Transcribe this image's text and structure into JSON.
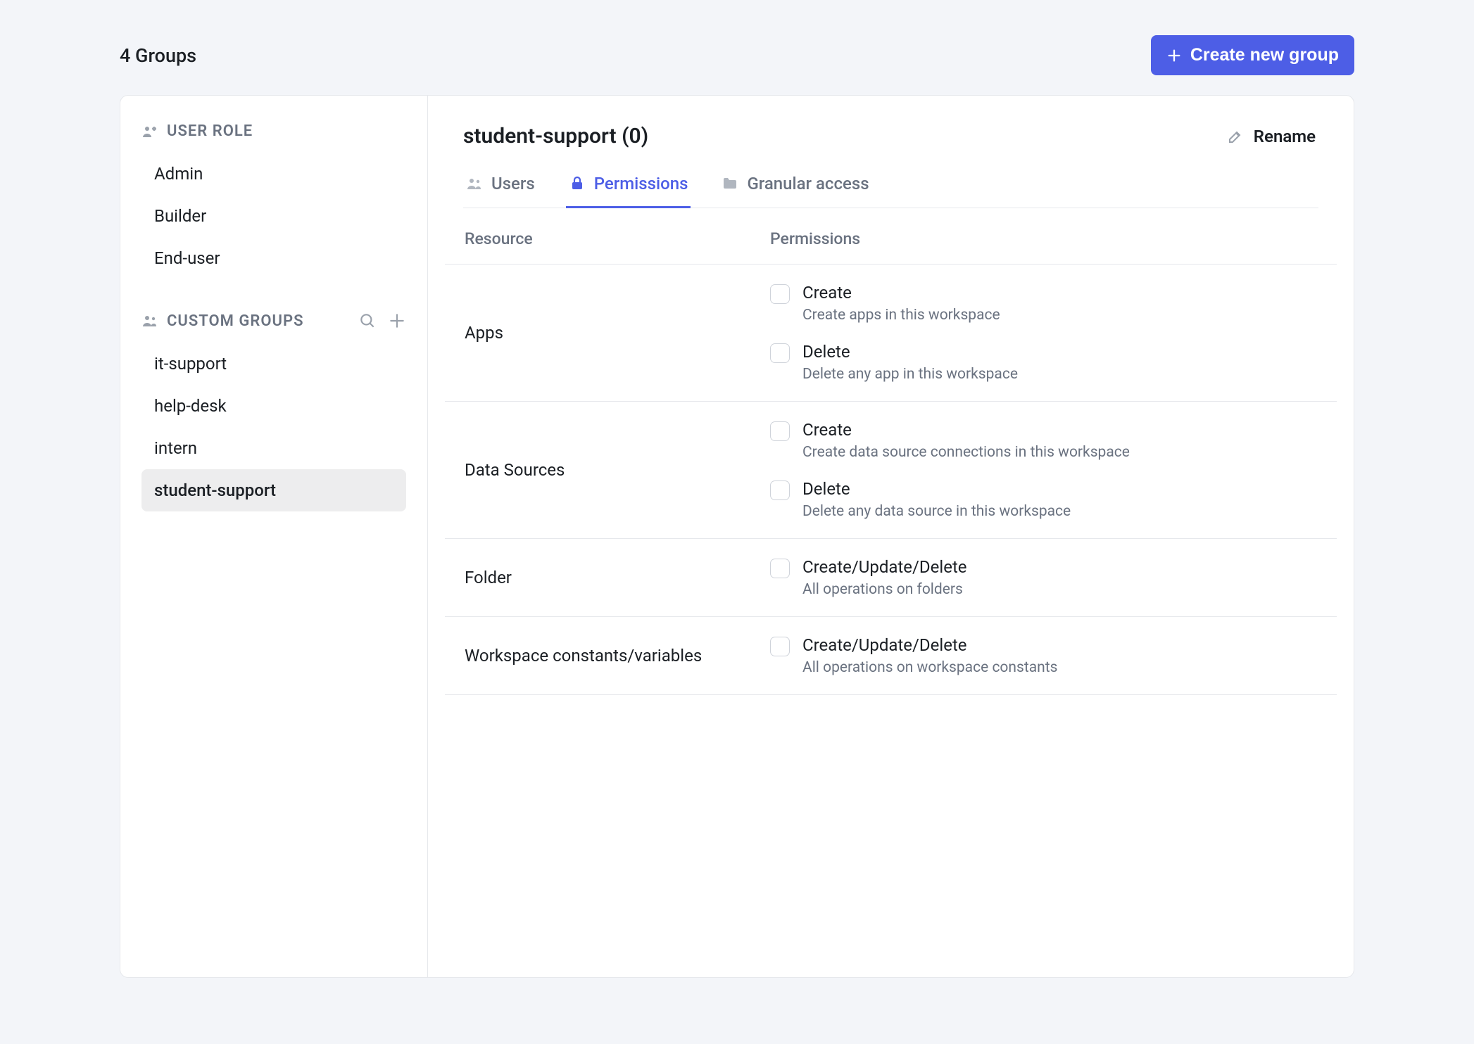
{
  "header": {
    "title": "4 Groups",
    "create_label": "Create new group"
  },
  "sidebar": {
    "user_role_label": "USER ROLE",
    "user_roles": [
      {
        "label": "Admin"
      },
      {
        "label": "Builder"
      },
      {
        "label": "End-user"
      }
    ],
    "custom_groups_label": "CUSTOM GROUPS",
    "custom_groups": [
      {
        "label": "it-support"
      },
      {
        "label": "help-desk"
      },
      {
        "label": "intern"
      },
      {
        "label": "student-support",
        "active": true
      }
    ]
  },
  "main": {
    "group_title": "student-support (0)",
    "rename_label": "Rename",
    "tabs": [
      {
        "label": "Users"
      },
      {
        "label": "Permissions",
        "active": true
      },
      {
        "label": "Granular access"
      }
    ],
    "columns": {
      "resource": "Resource",
      "permissions": "Permissions"
    },
    "resources": [
      {
        "name": "Apps",
        "permissions": [
          {
            "title": "Create",
            "desc": "Create apps in this workspace",
            "checked": false
          },
          {
            "title": "Delete",
            "desc": "Delete any app in this workspace",
            "checked": false
          }
        ]
      },
      {
        "name": "Data Sources",
        "permissions": [
          {
            "title": "Create",
            "desc": "Create data source connections in this workspace",
            "checked": false
          },
          {
            "title": "Delete",
            "desc": "Delete any data source in this workspace",
            "checked": false
          }
        ]
      },
      {
        "name": "Folder",
        "permissions": [
          {
            "title": "Create/Update/Delete",
            "desc": "All operations on folders",
            "checked": false
          }
        ]
      },
      {
        "name": "Workspace constants/variables",
        "permissions": [
          {
            "title": "Create/Update/Delete",
            "desc": "All operations on workspace constants",
            "checked": false
          }
        ]
      }
    ]
  }
}
